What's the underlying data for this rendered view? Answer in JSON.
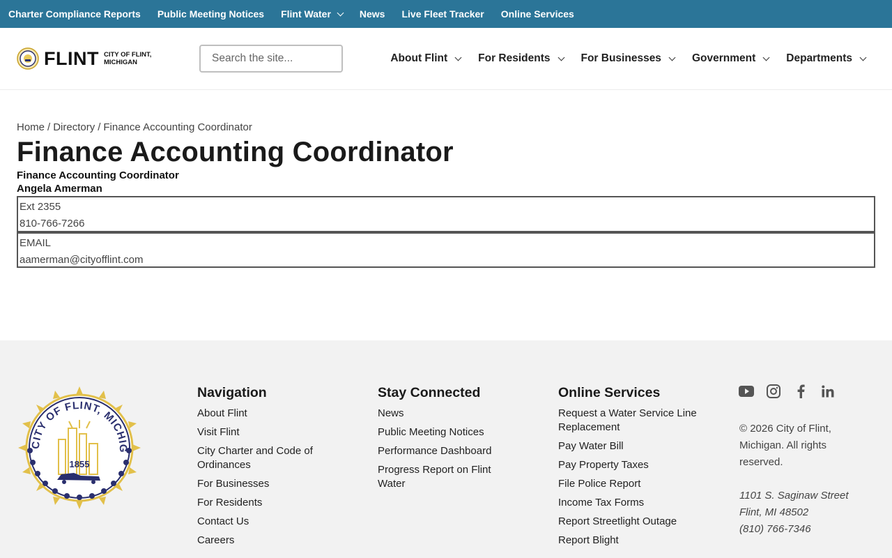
{
  "topbar": {
    "items": [
      {
        "label": "Charter Compliance Reports"
      },
      {
        "label": "Public Meeting Notices"
      },
      {
        "label": "Flint Water",
        "has_dropdown": true
      },
      {
        "label": "News"
      },
      {
        "label": "Live Fleet Tracker"
      },
      {
        "label": "Online Services"
      }
    ],
    "bg_color": "#2b7598"
  },
  "header": {
    "logo_word": "FLINT",
    "logo_sub_line1": "CITY OF FLINT,",
    "logo_sub_line2": "MICHIGAN",
    "search_placeholder": "Search the site...",
    "nav": [
      {
        "label": "About Flint"
      },
      {
        "label": "For Residents"
      },
      {
        "label": "For Businesses"
      },
      {
        "label": "Government"
      },
      {
        "label": "Departments"
      }
    ]
  },
  "breadcrumb": {
    "home": "Home",
    "directory": "Directory",
    "current": "Finance Accounting Coordinator",
    "separator": "/"
  },
  "page": {
    "title": "Finance Accounting Coordinator",
    "position": "Finance Accounting Coordinator",
    "person": "Angela Amerman",
    "phone_ext": "Ext 2355",
    "phone": "810-766-7266",
    "email_label": "EMAIL",
    "email": "aamerman@cityofflint.com"
  },
  "footer": {
    "seal_text": "CITY OF FLINT, MICHIGAN",
    "seal_year": "1855",
    "navigation": {
      "heading": "Navigation",
      "links": [
        "About Flint",
        "Visit Flint",
        "City Charter and Code of Ordinances",
        "For Businesses",
        "For Residents",
        "Contact Us",
        "Careers"
      ]
    },
    "stay_connected": {
      "heading": "Stay Connected",
      "links": [
        "News",
        "Public Meeting Notices",
        "Performance Dashboard",
        "Progress Report on Flint Water"
      ]
    },
    "online_services": {
      "heading": "Online Services",
      "links": [
        "Request a Water Service Line Replacement",
        "Pay Water Bill",
        "Pay Property Taxes",
        "File Police Report",
        "Income Tax Forms",
        "Report Streetlight Outage",
        "Report Blight"
      ]
    },
    "social": [
      "youtube-icon",
      "instagram-icon",
      "facebook-icon",
      "linkedin-icon"
    ],
    "copyright": "© 2026 City of Flint, Michigan. All rights reserved.",
    "address_line1": "1101 S. Saginaw Street",
    "address_line2": "Flint, MI 48502",
    "address_phone": "(810) 766-7346"
  }
}
